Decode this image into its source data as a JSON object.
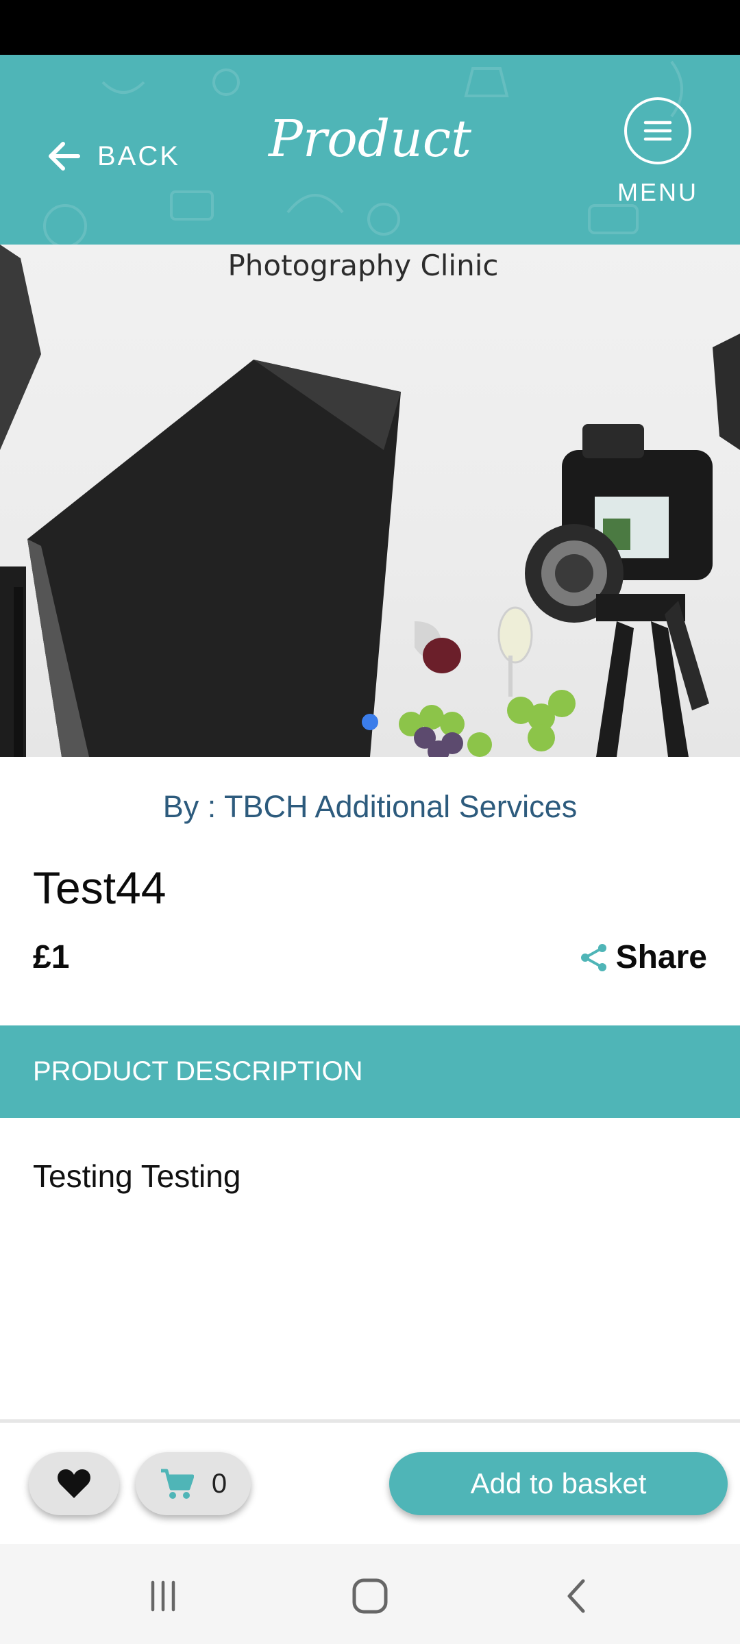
{
  "header": {
    "back_label": "BACK",
    "title": "Product",
    "menu_label": "MENU"
  },
  "hero": {
    "caption": "Photography Clinic",
    "slide_count": 1,
    "active_slide": 1
  },
  "product": {
    "seller": "By : TBCH Additional Services",
    "title": "Test44",
    "price": "£1",
    "share_label": "Share"
  },
  "description": {
    "heading": "PRODUCT DESCRIPTION",
    "text": "Testing Testing"
  },
  "actions": {
    "cart_count": "0",
    "add_to_basket_label": "Add to basket"
  },
  "colors": {
    "accent": "#4fb5b7",
    "seller_text": "#2d5b7d",
    "carousel_dot": "#3b7dea"
  },
  "icons": [
    "arrow-left-icon",
    "hamburger-icon",
    "share-icon",
    "heart-icon",
    "cart-icon",
    "recents-icon",
    "home-icon",
    "back-nav-icon"
  ]
}
